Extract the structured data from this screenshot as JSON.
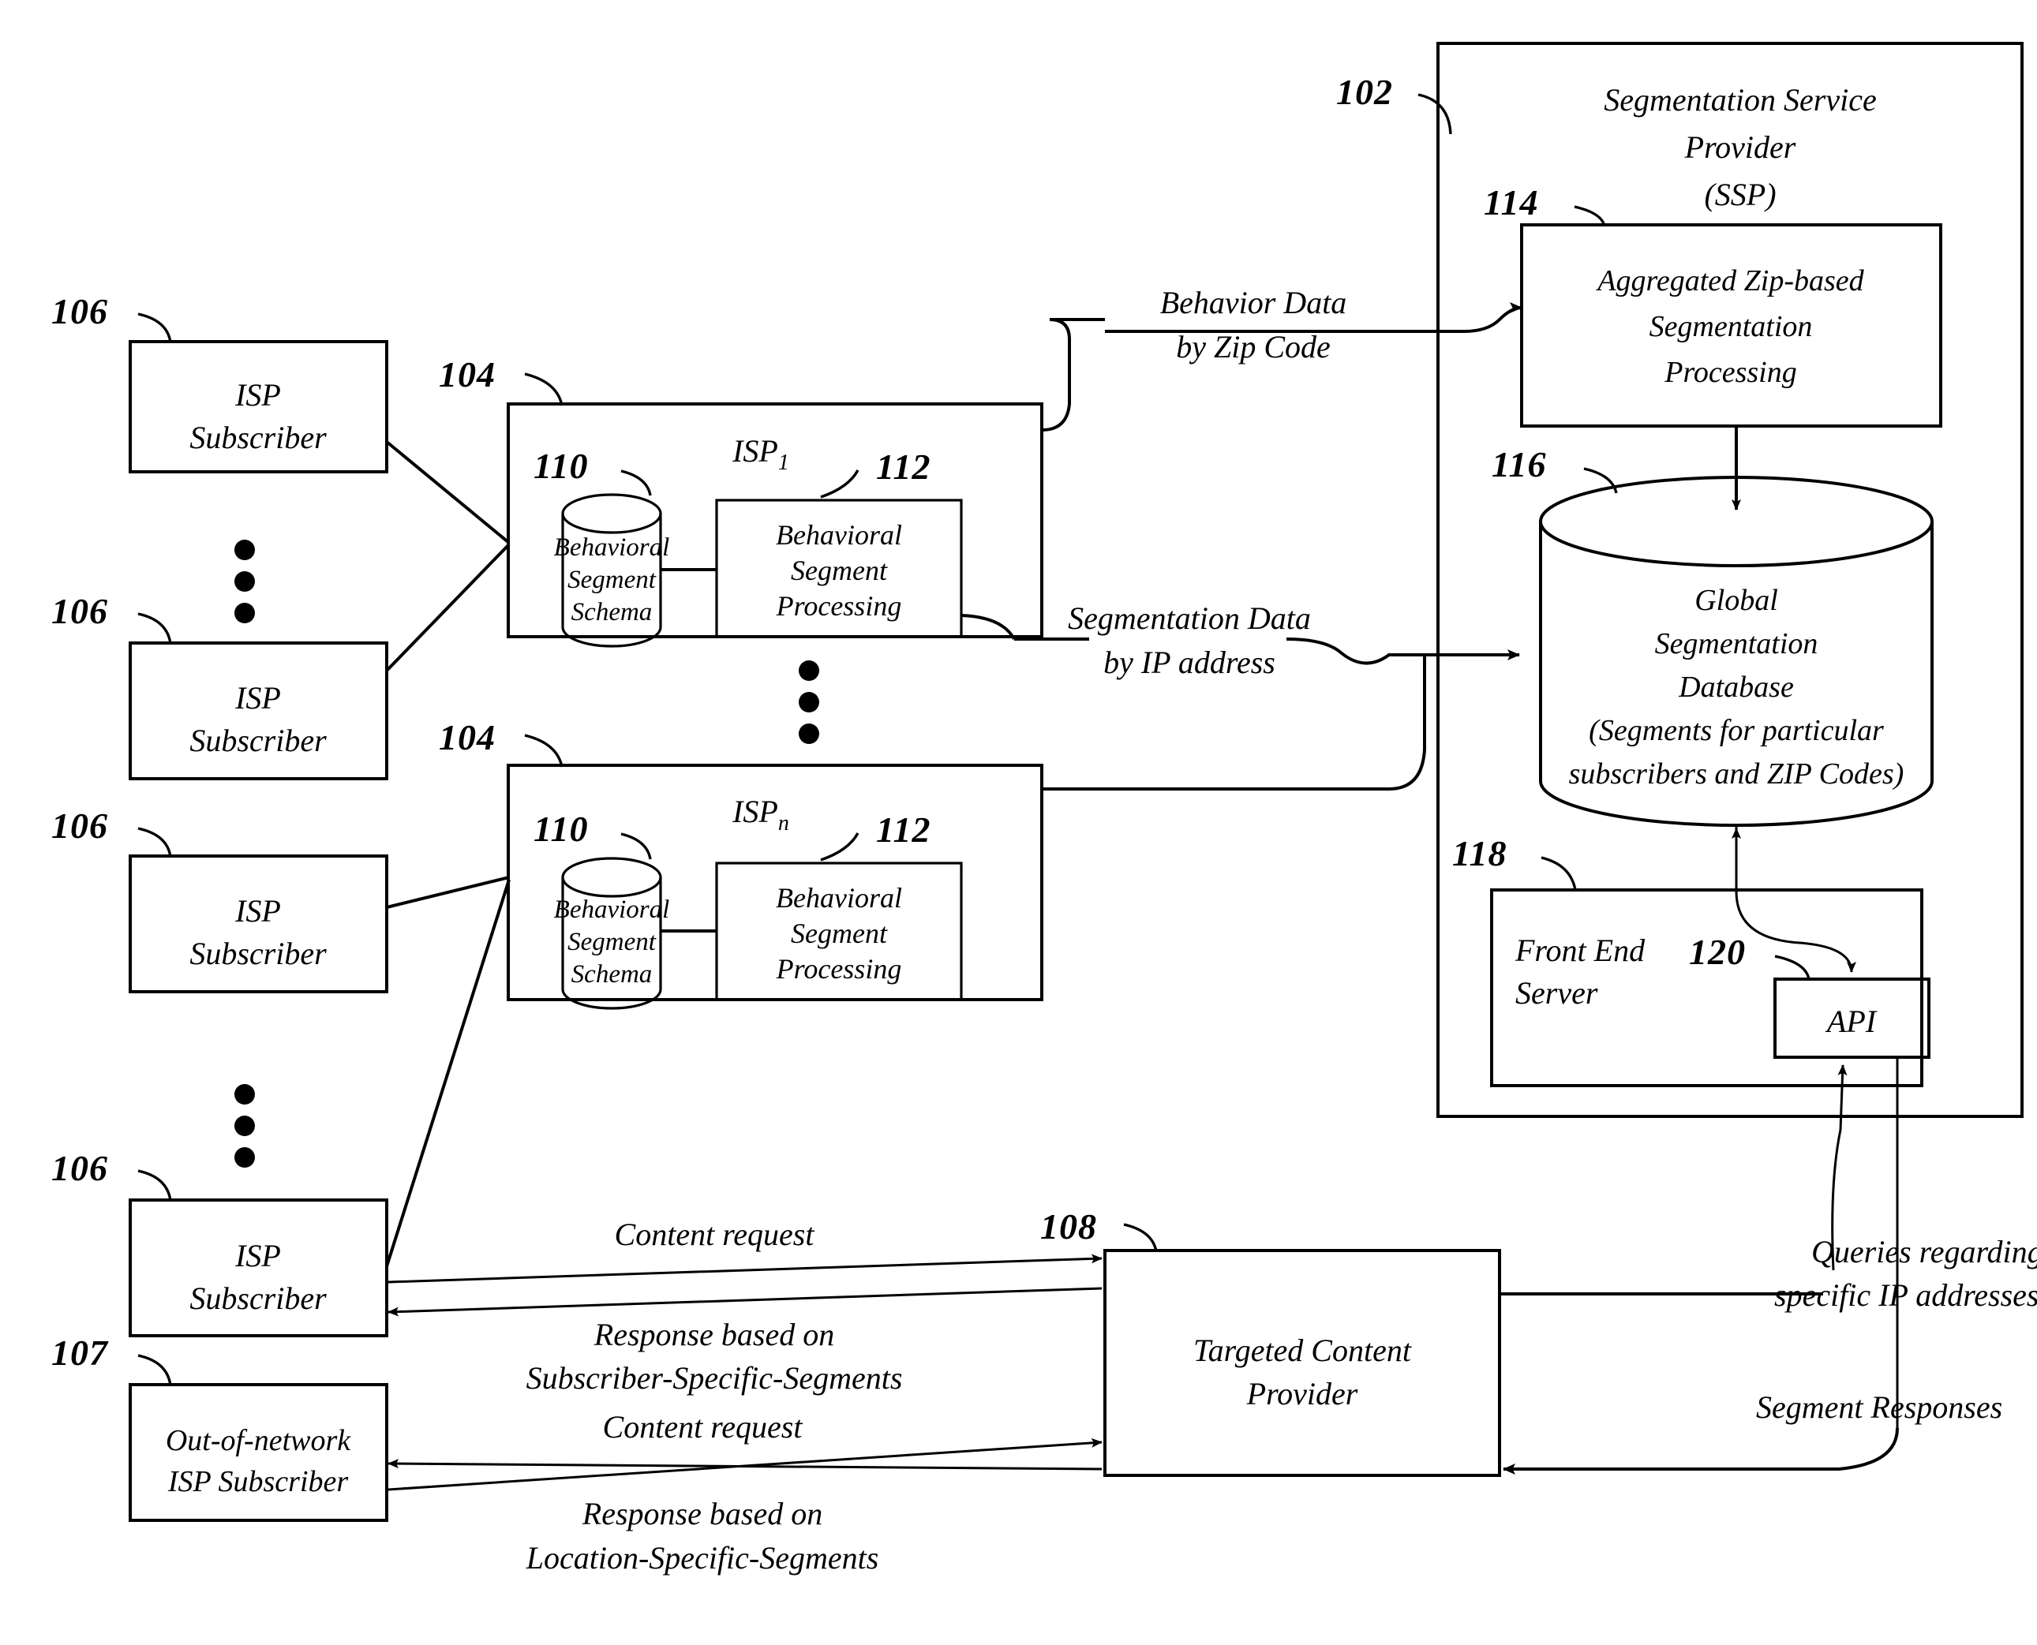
{
  "figure": {
    "type": "patent-block-diagram",
    "background_color": "#ffffff",
    "line_color": "#000000"
  },
  "reference_numerals": {
    "ssp": "102",
    "isp_1": "104",
    "isp_n": "104",
    "subscriber_1": "106",
    "subscriber_2": "106",
    "subscriber_3": "106",
    "out_of_network_subscriber": "107",
    "targeted_content_provider": "108",
    "behavioral_segment_schema_1": "110",
    "behavioral_segment_schema_n": "110",
    "behavioral_segment_processing_1": "112",
    "behavioral_segment_processing_n": "112",
    "aggregated_zip_processing": "114",
    "global_segmentation_database": "116",
    "front_end_server": "118",
    "api": "120"
  },
  "nodes": {
    "ssp_container": {
      "line1": "Segmentation Service",
      "line2": "Provider",
      "line3": "(SSP)"
    },
    "aggregated_zip_processing": {
      "line1": "Aggregated Zip-based",
      "line2": "Segmentation",
      "line3": "Processing"
    },
    "global_segmentation_database": {
      "line1": "Global",
      "line2": "Segmentation",
      "line3": "Database",
      "line4": "(Segments for particular",
      "line5": "subscribers and ZIP Codes)"
    },
    "front_end_server": {
      "line1": "Front End",
      "line2": "Server"
    },
    "api": {
      "label": "API"
    },
    "isp_1": {
      "title_main": "ISP",
      "title_sub": "1"
    },
    "isp_n": {
      "title_main": "ISP",
      "title_sub": "n"
    },
    "behavioral_segment_schema": {
      "line1": "Behavioral",
      "line2": "Segment",
      "line3": "Schema"
    },
    "behavioral_segment_processing": {
      "line1": "Behavioral",
      "line2": "Segment",
      "line3": "Processing"
    },
    "subscriber": {
      "line1": "ISP",
      "line2": "Subscriber"
    },
    "out_of_network_subscriber": {
      "line1": "Out-of-network",
      "line2": "ISP Subscriber"
    },
    "targeted_content_provider": {
      "line1": "Targeted Content",
      "line2": "Provider"
    }
  },
  "flow_labels": {
    "behavior_data_zip": {
      "line1": "Behavior Data",
      "line2": "by Zip Code"
    },
    "segmentation_data_ip": {
      "line1": "Segmentation Data",
      "line2": "by IP address"
    },
    "content_request_1": "Content request",
    "response_subscriber_specific": {
      "line1": "Response based on",
      "line2": "Subscriber-Specific-Segments"
    },
    "content_request_2": "Content request",
    "response_location_specific": {
      "line1": "Response based on",
      "line2": "Location-Specific-Segments"
    },
    "queries_ip": {
      "line1": "Queries regarding",
      "line2": "specific IP addresses"
    },
    "segment_responses": "Segment Responses"
  }
}
